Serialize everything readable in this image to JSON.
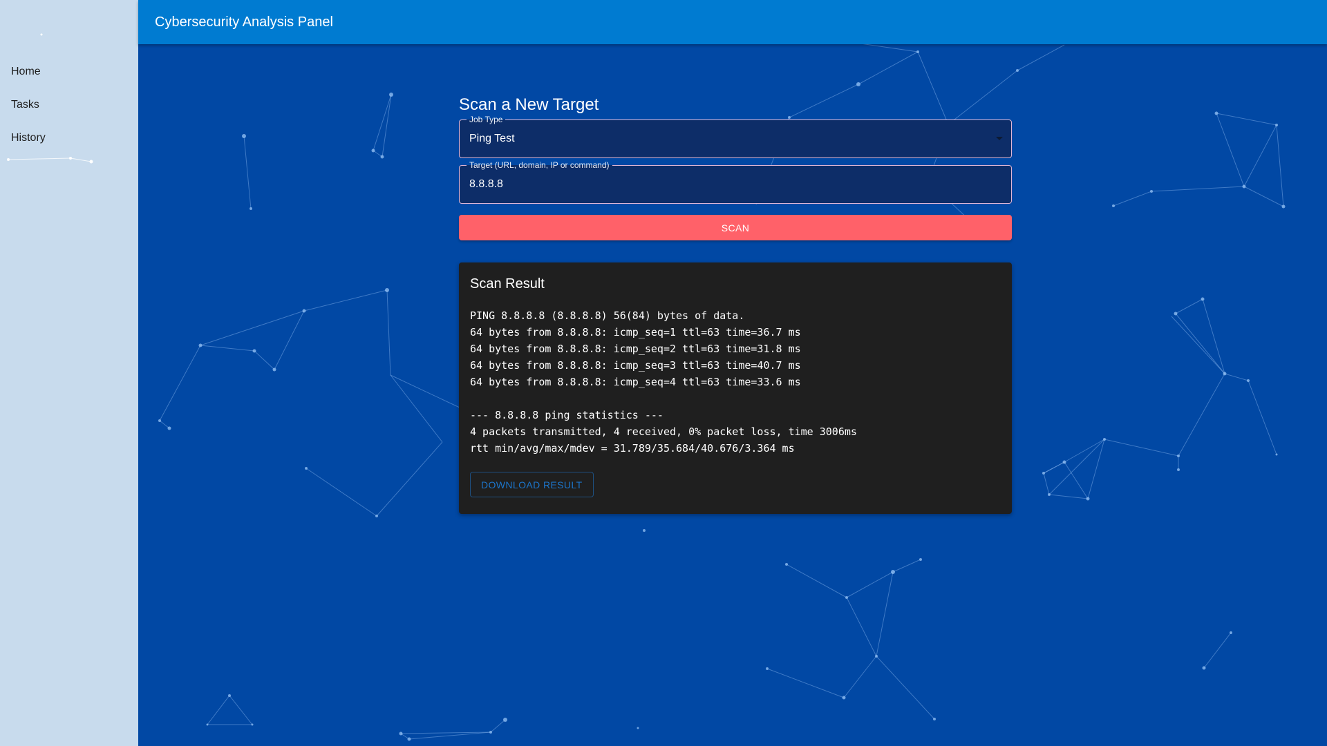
{
  "app": {
    "title": "Cybersecurity Analysis Panel"
  },
  "sidebar": {
    "items": [
      {
        "label": "Home"
      },
      {
        "label": "Tasks"
      },
      {
        "label": "History"
      }
    ]
  },
  "scan_form": {
    "heading": "Scan a New Target",
    "job_type": {
      "label": "Job Type",
      "selected": "Ping Test"
    },
    "target": {
      "label": "Target (URL, domain, IP or command)",
      "value": "8.8.8.8"
    },
    "scan_button": "SCAN"
  },
  "result": {
    "heading": "Scan Result",
    "lines": [
      "PING 8.8.8.8 (8.8.8.8) 56(84) bytes of data.",
      "64 bytes from 8.8.8.8: icmp_seq=1 ttl=63 time=36.7 ms",
      "64 bytes from 8.8.8.8: icmp_seq=2 ttl=63 time=31.8 ms",
      "64 bytes from 8.8.8.8: icmp_seq=3 ttl=63 time=40.7 ms",
      "64 bytes from 8.8.8.8: icmp_seq=4 ttl=63 time=33.6 ms",
      "",
      "--- 8.8.8.8 ping statistics ---",
      "4 packets transmitted, 4 received, 0% packet loss, time 3006ms",
      "rtt min/avg/max/mdev = 31.789/35.684/40.676/3.364 ms"
    ],
    "download_button": "DOWNLOAD RESULT"
  },
  "colors": {
    "background": "#0148a4",
    "appbar": "#007bd1",
    "sidebar": "#c8dbed",
    "accent_button": "#ff6169",
    "result_card": "#1f1f1f"
  }
}
